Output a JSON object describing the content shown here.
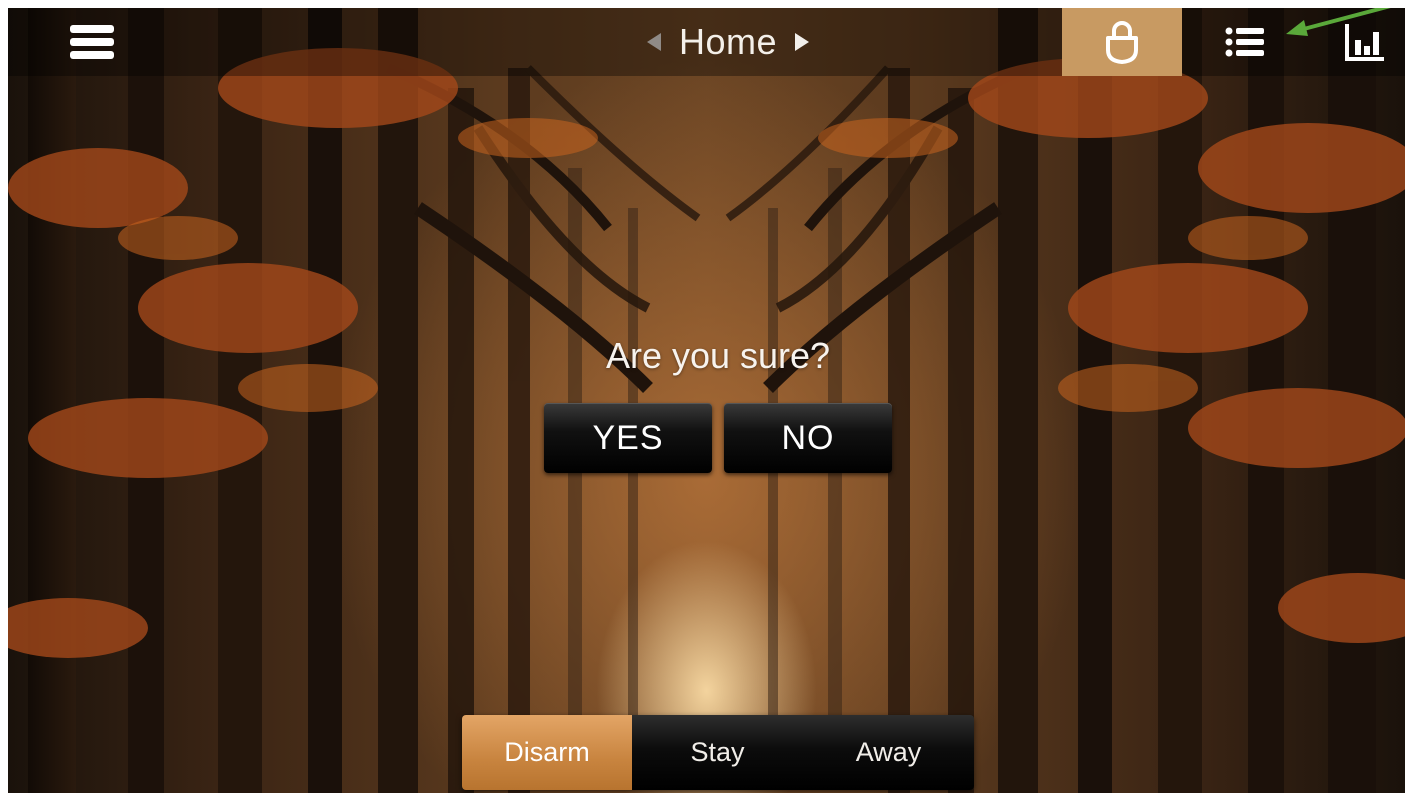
{
  "header": {
    "title": "Home",
    "prev_icon": "triangle-left-icon",
    "next_icon": "triangle-right-icon",
    "menu_icon": "hamburger-menu-icon",
    "lock_icon": "padlock-icon",
    "list_icon": "list-icon",
    "chart_icon": "bar-chart-icon",
    "active_tab_color": "#c89a62"
  },
  "dialog": {
    "prompt": "Are you sure?",
    "yes_label": "YES",
    "no_label": "NO"
  },
  "modes": {
    "items": [
      {
        "label": "Disarm",
        "active": true
      },
      {
        "label": "Stay",
        "active": false
      },
      {
        "label": "Away",
        "active": false
      }
    ],
    "active_color": "#d6934f"
  },
  "annotation": {
    "arrow_color": "#5aa83a"
  }
}
